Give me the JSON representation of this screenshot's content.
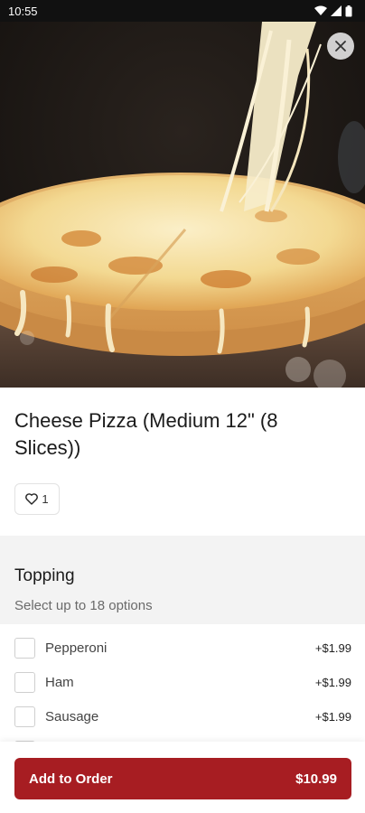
{
  "status_bar": {
    "time": "10:55"
  },
  "product": {
    "title": "Cheese Pizza (Medium 12\" (8 Slices))",
    "likes": "1"
  },
  "topping_section": {
    "title": "Topping",
    "subtitle": "Select up to 18 options",
    "options": [
      {
        "label": "Pepperoni",
        "price": "+$1.99",
        "checked": false
      },
      {
        "label": "Ham",
        "price": "+$1.99",
        "checked": false
      },
      {
        "label": "Sausage",
        "price": "+$1.99",
        "checked": false
      }
    ]
  },
  "footer": {
    "button_label": "Add to Order",
    "total": "$10.99"
  },
  "colors": {
    "accent": "#a71d22",
    "section_bg": "#f3f3f3"
  },
  "icons": {
    "close": "close-icon",
    "like": "heart-icon"
  }
}
